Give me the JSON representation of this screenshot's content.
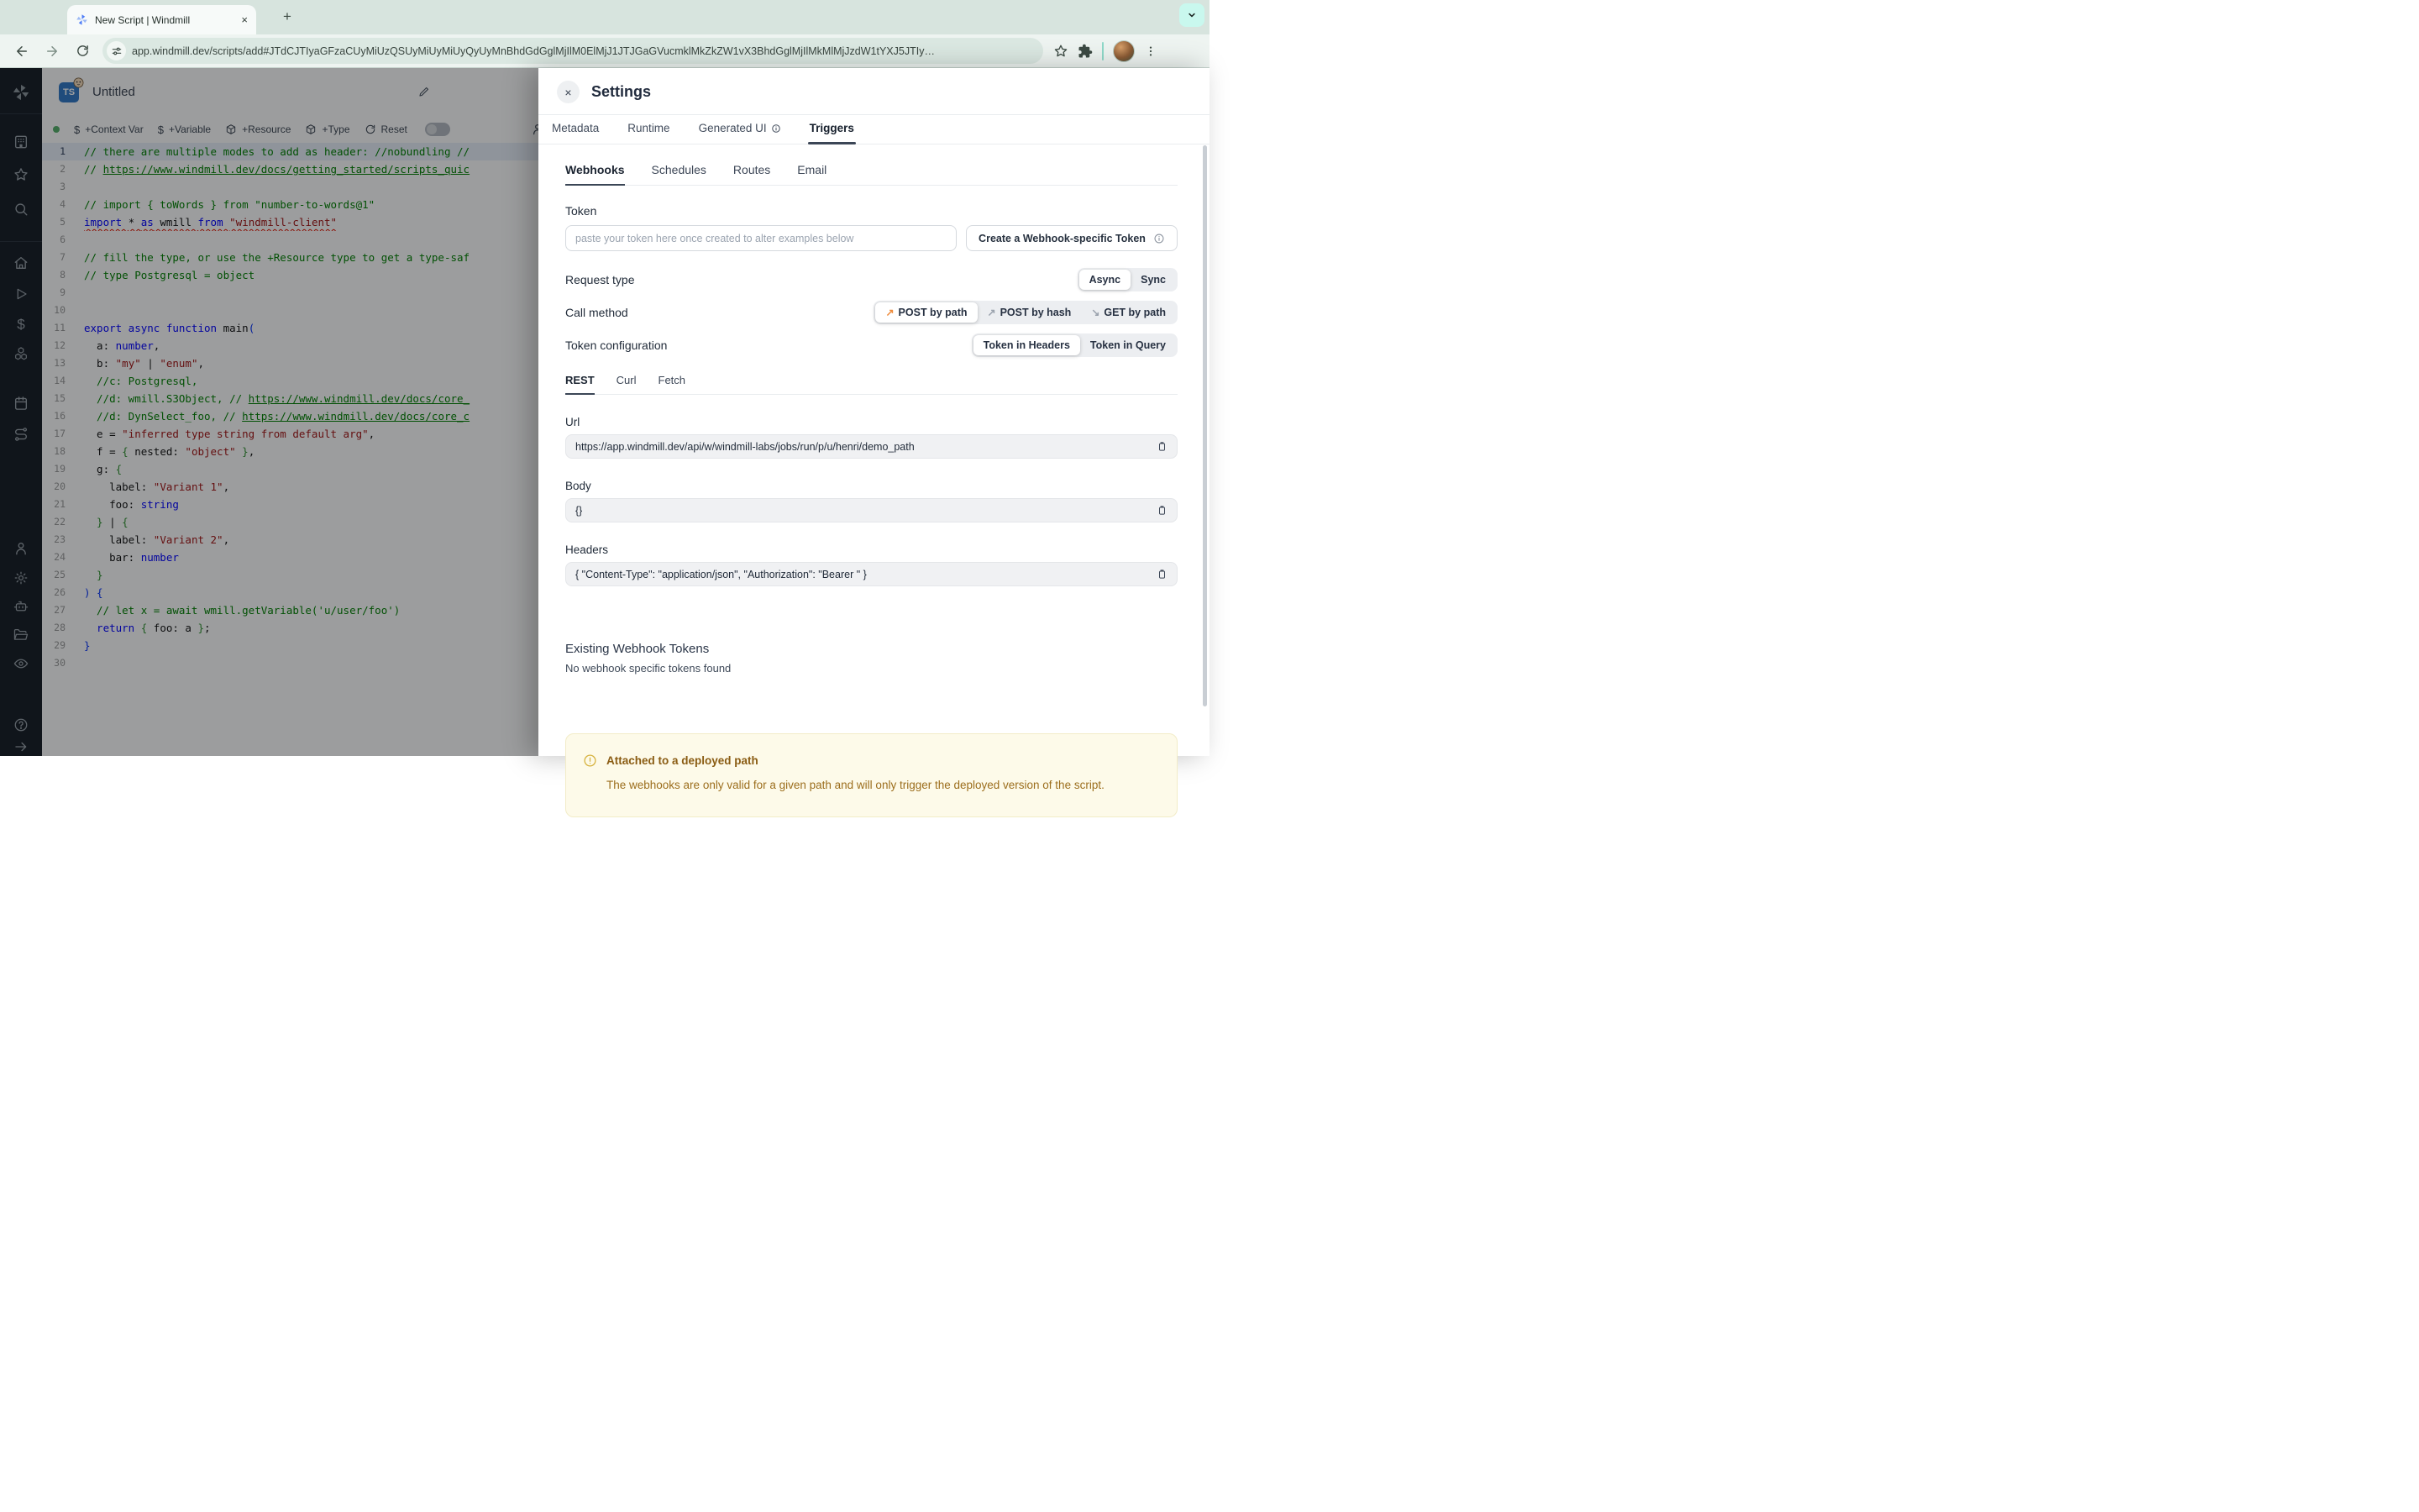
{
  "browser": {
    "tab_title": "New Script | Windmill",
    "new_tab_label": "+",
    "close_tab_label": "×",
    "url": "app.windmill.dev/scripts/add#JTdCJTIyaGFzaCUyMiUzQSUyMiUyMiUyQyUyMnBhdGdGglMjIlM0ElMjJ1JTJGaGVucmklMkZkZW1vX3BhdGglMjIlMkMlMjJzdW1tYXJ5JTIy…"
  },
  "sidebar": {
    "icons": [
      "windmill-logo",
      "workspace-board",
      "favorites-star",
      "search",
      "home",
      "runs-play",
      "variables-dollar",
      "resources-cubes",
      "schedules-calendar",
      "routes",
      "users-person",
      "settings-gear",
      "workers-robot",
      "folders",
      "audit-eye",
      "help",
      "expand-arrow"
    ]
  },
  "editor": {
    "language_badge": "TS",
    "title": "Untitled",
    "toolbar": {
      "context_var": "+Context Var",
      "variable": "+Variable",
      "resource": "+Resource",
      "type": "+Type",
      "reset": "Reset"
    },
    "lines": [
      {
        "n": 1,
        "active": true,
        "t": [
          [
            "cm",
            "// there are multiple modes to add as header: //nobundling //"
          ]
        ]
      },
      {
        "n": 2,
        "t": [
          [
            "cm",
            "// "
          ],
          [
            "lk",
            "https://www.windmill.dev/docs/getting_started/scripts_quic"
          ]
        ]
      },
      {
        "n": 3,
        "t": []
      },
      {
        "n": 4,
        "t": [
          [
            "cm",
            "// import { toWords } from \"number-to-words@1\""
          ]
        ]
      },
      {
        "n": 5,
        "t": [
          [
            "kw sq",
            "import "
          ],
          [
            "pl sq",
            "* "
          ],
          [
            "kw sq",
            "as"
          ],
          [
            "pl sq",
            " wmill "
          ],
          [
            "kw sq",
            "from "
          ],
          [
            "st sq",
            "\"windmill-client\""
          ]
        ]
      },
      {
        "n": 6,
        "t": []
      },
      {
        "n": 7,
        "t": [
          [
            "cm",
            "// fill the type, or use the +Resource type to get a type-saf"
          ]
        ]
      },
      {
        "n": 8,
        "t": [
          [
            "cm",
            "// type Postgresql = object"
          ]
        ]
      },
      {
        "n": 9,
        "t": []
      },
      {
        "n": 10,
        "t": []
      },
      {
        "n": 11,
        "t": [
          [
            "kw",
            "export async function "
          ],
          [
            "fn",
            "main"
          ],
          [
            "b1",
            "("
          ]
        ]
      },
      {
        "n": 12,
        "t": [
          [
            "pl",
            "  a: "
          ],
          [
            "kw",
            "number"
          ],
          [
            "pl",
            ","
          ]
        ]
      },
      {
        "n": 13,
        "t": [
          [
            "pl",
            "  b: "
          ],
          [
            "st",
            "\"my\""
          ],
          [
            "pl",
            " | "
          ],
          [
            "st",
            "\"enum\""
          ],
          [
            "pl",
            ","
          ]
        ]
      },
      {
        "n": 14,
        "t": [
          [
            "cm",
            "  //c: Postgresql,"
          ]
        ]
      },
      {
        "n": 15,
        "t": [
          [
            "cm",
            "  //d: wmill.S3Object, // "
          ],
          [
            "lk",
            "https://www.windmill.dev/docs/core_"
          ]
        ]
      },
      {
        "n": 16,
        "t": [
          [
            "cm",
            "  //d: DynSelect_foo, // "
          ],
          [
            "lk",
            "https://www.windmill.dev/docs/core_c"
          ]
        ]
      },
      {
        "n": 17,
        "t": [
          [
            "pl",
            "  e = "
          ],
          [
            "st",
            "\"inferred type string from default arg\""
          ],
          [
            "pl",
            ","
          ]
        ]
      },
      {
        "n": 18,
        "t": [
          [
            "pl",
            "  f = "
          ],
          [
            "b2",
            "{"
          ],
          [
            "pl",
            " nested: "
          ],
          [
            "st",
            "\"object\""
          ],
          [
            "pl",
            " "
          ],
          [
            "b2",
            "}"
          ],
          [
            "pl",
            ","
          ]
        ]
      },
      {
        "n": 19,
        "t": [
          [
            "pl",
            "  g: "
          ],
          [
            "b2",
            "{"
          ]
        ]
      },
      {
        "n": 20,
        "t": [
          [
            "pl",
            "    label: "
          ],
          [
            "st",
            "\"Variant 1\""
          ],
          [
            "pl",
            ","
          ]
        ]
      },
      {
        "n": 21,
        "t": [
          [
            "pl",
            "    foo: "
          ],
          [
            "kw",
            "string"
          ]
        ]
      },
      {
        "n": 22,
        "t": [
          [
            "b2",
            "  }"
          ],
          [
            "pl",
            " | "
          ],
          [
            "b2",
            "{"
          ]
        ]
      },
      {
        "n": 23,
        "t": [
          [
            "pl",
            "    label: "
          ],
          [
            "st",
            "\"Variant 2\""
          ],
          [
            "pl",
            ","
          ]
        ]
      },
      {
        "n": 24,
        "t": [
          [
            "pl",
            "    bar: "
          ],
          [
            "kw",
            "number"
          ]
        ]
      },
      {
        "n": 25,
        "t": [
          [
            "b2",
            "  }"
          ]
        ]
      },
      {
        "n": 26,
        "t": [
          [
            "b1",
            ") {"
          ]
        ]
      },
      {
        "n": 27,
        "t": [
          [
            "cm",
            "  // let x = await wmill.getVariable('u/user/foo')"
          ]
        ]
      },
      {
        "n": 28,
        "t": [
          [
            "kw",
            "  return "
          ],
          [
            "b2",
            "{"
          ],
          [
            "pl",
            " foo: a "
          ],
          [
            "b2",
            "}"
          ],
          [
            "pl",
            ";"
          ]
        ]
      },
      {
        "n": 29,
        "t": [
          [
            "b1",
            "}"
          ]
        ]
      },
      {
        "n": 30,
        "t": []
      }
    ]
  },
  "settings": {
    "title": "Settings",
    "close_label": "×",
    "tabs": [
      "Metadata",
      "Runtime",
      "Generated UI",
      "Triggers"
    ],
    "active_tab": "Triggers",
    "trigger_tabs": [
      "Webhooks",
      "Schedules",
      "Routes",
      "Email"
    ],
    "active_trigger_tab": "Webhooks",
    "token": {
      "label": "Token",
      "placeholder": "paste your token here once created to alter examples below",
      "create_button": "Create a Webhook-specific Token"
    },
    "request_type": {
      "label": "Request type",
      "options": [
        "Async",
        "Sync"
      ],
      "selected": "Async"
    },
    "call_method": {
      "label": "Call method",
      "options": [
        "POST by path",
        "POST by hash",
        "GET by path"
      ],
      "selected": "POST by path"
    },
    "token_configuration": {
      "label": "Token configuration",
      "options": [
        "Token in Headers",
        "Token in Query"
      ],
      "selected": "Token in Headers"
    },
    "example_tabs": [
      "REST",
      "Curl",
      "Fetch"
    ],
    "active_example_tab": "REST",
    "url_field": {
      "label": "Url",
      "value": "https://app.windmill.dev/api/w/windmill-labs/jobs/run/p/u/henri/demo_path"
    },
    "body_field": {
      "label": "Body",
      "value": "{}"
    },
    "headers_field": {
      "label": "Headers",
      "value": "{ \"Content-Type\": \"application/json\", \"Authorization\": \"Bearer \" }"
    },
    "existing_tokens": {
      "title": "Existing Webhook Tokens",
      "empty_message": "No webhook specific tokens found"
    },
    "warning": {
      "title": "Attached to a deployed path",
      "body": "The webhooks are only valid for a given path and will only trigger the deployed version of the script."
    }
  },
  "colors": {
    "accent_orange": "#ee8a3a",
    "chrome_bg": "#d7e4de",
    "sidebar_bg": "#171d25",
    "warning_bg": "#fdfae9",
    "warning_border": "#f2ecc7",
    "warning_text": "#9c6e1d",
    "ts_badge": "#3178c6"
  }
}
